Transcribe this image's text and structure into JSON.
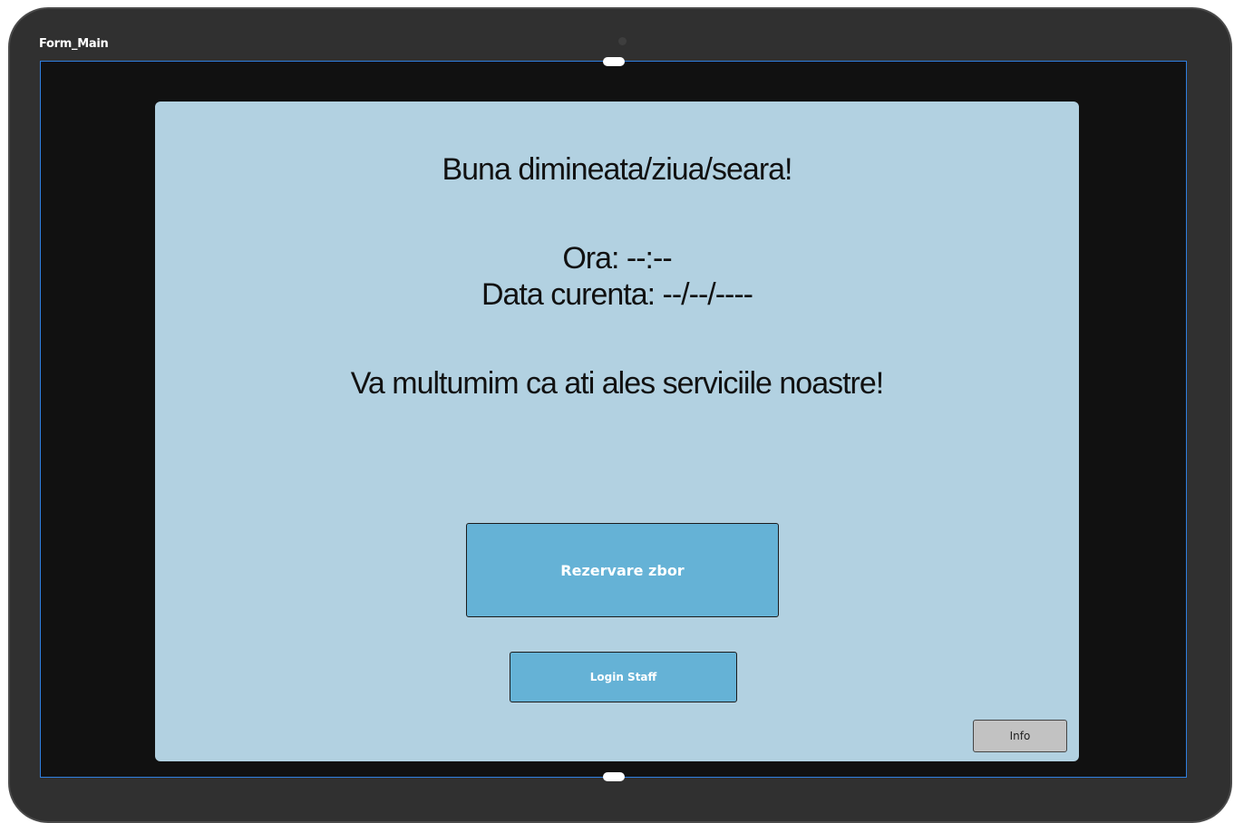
{
  "designer": {
    "frame_title": "Form_Main"
  },
  "form": {
    "greeting": "Buna dimineata/ziua/seara!",
    "time_text": "Ora: --:--",
    "date_text": "Data curenta: --/--/----",
    "thanks_text": "Va multumim ca ati ales serviciile noastre!",
    "reserve_button": "Rezervare zbor",
    "login_button": "Login Staff",
    "info_button": "Info"
  },
  "colors": {
    "form_background": "#b2d1e1",
    "button_primary": "#65b2d6",
    "button_info": "#c2c2c2",
    "selection_border": "#2f7fe0",
    "canvas_background": "#111111"
  }
}
